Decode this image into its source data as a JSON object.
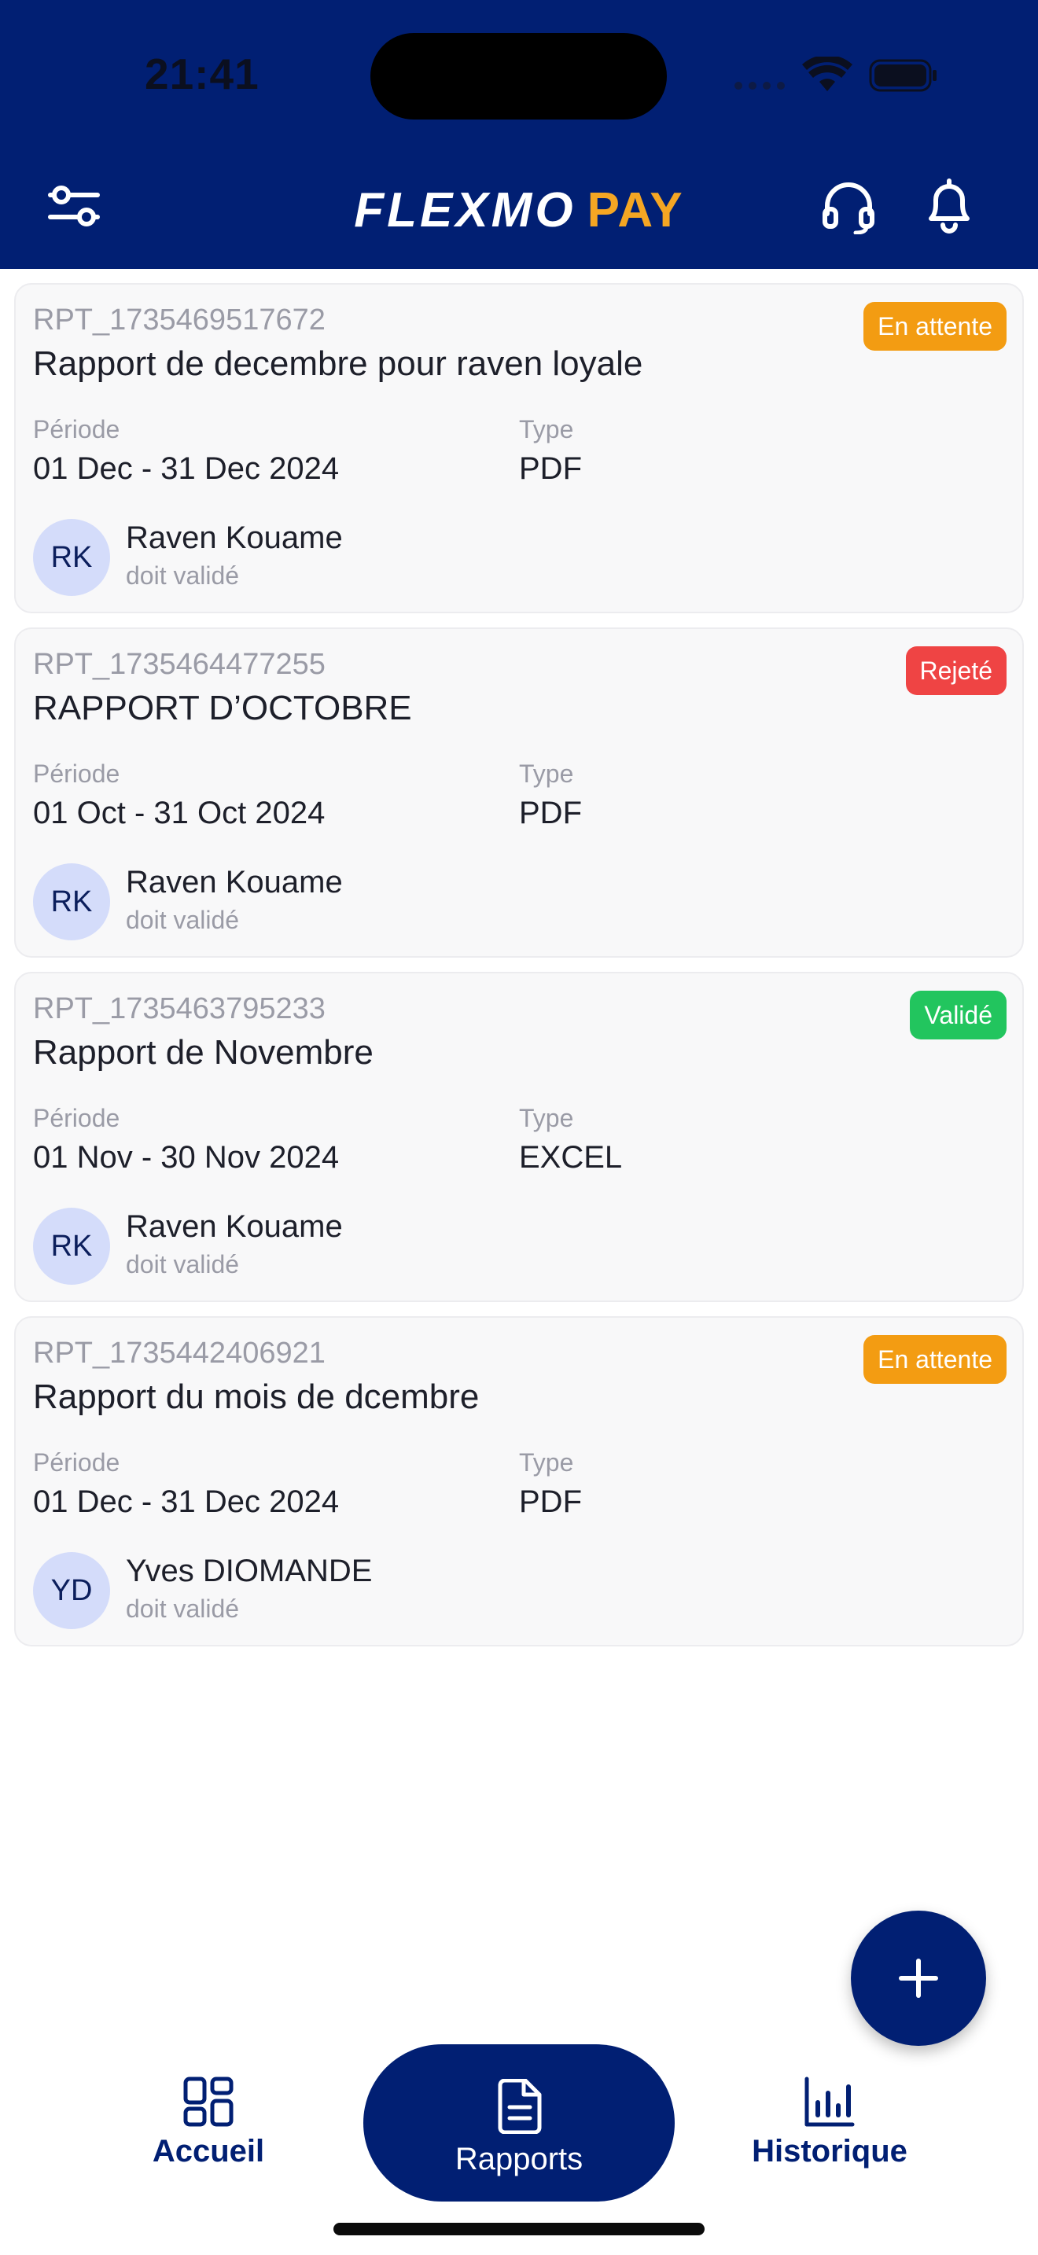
{
  "status_bar": {
    "time": "21:41"
  },
  "app": {
    "logo_main": "FLEXMO",
    "logo_accent": "PAY",
    "icons": {
      "filter": "sliders-icon",
      "support": "headset-icon",
      "notifications": "bell-icon"
    }
  },
  "colors": {
    "primary": "#011f73",
    "accent": "#f5a623",
    "pending": "#f39c12",
    "rejected": "#ef4444",
    "validated": "#22c55e"
  },
  "reports": [
    {
      "id": "RPT_1735469517672",
      "title": "Rapport de decembre pour raven loyale",
      "status": "En attente",
      "period_label": "Période",
      "period": "01 Dec - 31 Dec 2024",
      "type_label": "Type",
      "type": "PDF",
      "initials": "RK",
      "user": "Raven Kouame",
      "user_status": "doit validé"
    },
    {
      "id": "RPT_1735464477255",
      "title": "RAPPORT D’OCTOBRE",
      "status": "Rejeté",
      "period_label": "Période",
      "period": "01 Oct - 31 Oct 2024",
      "type_label": "Type",
      "type": "PDF",
      "initials": "RK",
      "user": "Raven Kouame",
      "user_status": "doit validé"
    },
    {
      "id": "RPT_1735463795233",
      "title": "Rapport de Novembre",
      "status": "Validé",
      "period_label": "Période",
      "period": "01 Nov - 30 Nov 2024",
      "type_label": "Type",
      "type": "EXCEL",
      "initials": "RK",
      "user": "Raven Kouame",
      "user_status": "doit validé"
    },
    {
      "id": "RPT_1735442406921",
      "title": "Rapport du mois de dcembre",
      "status": "En attente",
      "period_label": "Période",
      "period": "01 Dec - 31 Dec 2024",
      "type_label": "Type",
      "type": "PDF",
      "initials": "YD",
      "user": "Yves DIOMANDE",
      "user_status": "doit validé"
    }
  ],
  "fab": {
    "icon": "plus-icon"
  },
  "nav": {
    "home": {
      "label": "Accueil",
      "icon": "grid-icon"
    },
    "reports": {
      "label": "Rapports",
      "icon": "document-icon"
    },
    "history": {
      "label": "Historique",
      "icon": "bar-chart-icon"
    }
  }
}
